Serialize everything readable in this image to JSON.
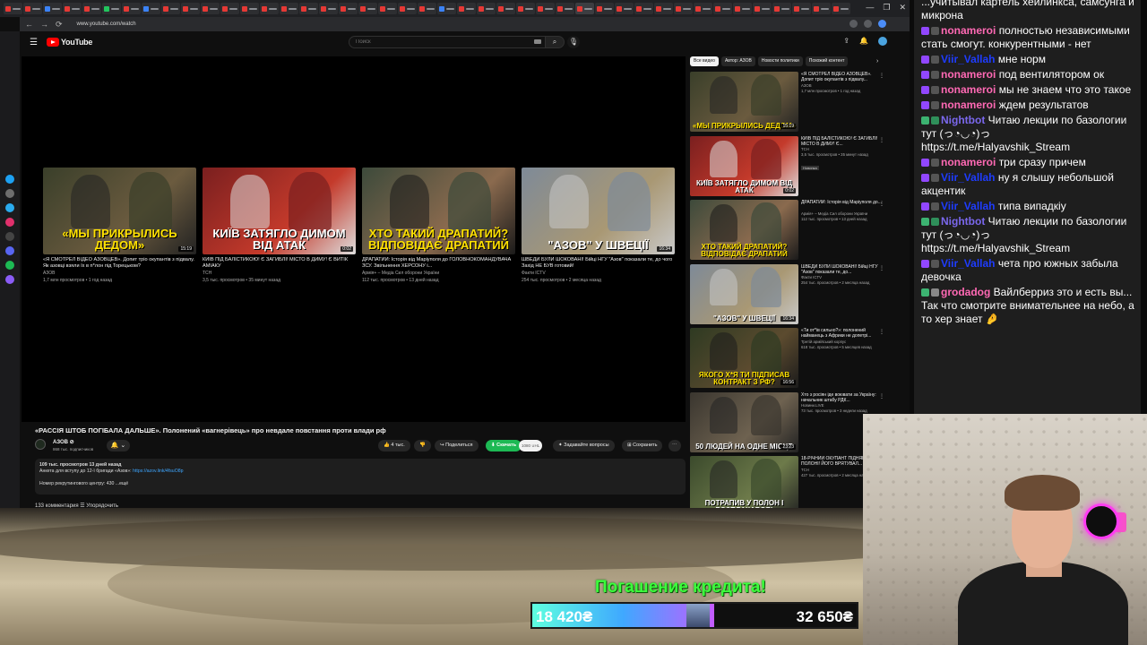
{
  "browser": {
    "url": "www.youtube.com/watch",
    "window_controls": [
      "—",
      "❐",
      "✕"
    ]
  },
  "youtube": {
    "logo_text": "YouTube",
    "search_placeholder": "Поиск",
    "endscreen": [
      {
        "title": "«Я СМОТРЕЛ ВІДЕО АЗОВЦЕВ». Допит тріо окупантів з підвалу. Як азовці взяли їх в п*лон під Торецьком?",
        "channel": "АЗОВ",
        "meta": "1,7 млн просмотров • 1 год назад",
        "duration": "15:19",
        "caption": "«МЫ ПРИКРЫЛИСЬ ДЕДОМ»"
      },
      {
        "title": "КИЇВ ПІД БАЛІСТИКОЮ! Є ЗАГИБЛІ! МІСТО В ДИМУ! Є ВИТІК АМІАКУ",
        "channel": "ТСН",
        "meta": "3,5 тыс. просмотров • 35 минут назад",
        "duration": "0:02",
        "caption": "КИЇВ ЗАТЯГЛО ДИМОМ ВІД АТАК"
      },
      {
        "title": "ДРАПАТИЙ: Історія від Маріуполя до ГОЛОВНОКОМАНДУВАЧА ЗСУ. Звільнення ХЕРСОНУ і...",
        "channel": "Армія+ – Медіа Сил оборони України",
        "meta": "112 тыс. просмотров • 13 дней назад",
        "duration": "",
        "caption": "ХТО ТАКИЙ ДРАПАТИЙ? ВІДПОВІДАЄ ДРАПАТИЙ"
      },
      {
        "title": "ШВЕДИ БУЛИ ШОКОВАНІ! Бійці НГУ \"Азов\" показали те, до чого Захід НЕ БУВ готовий!",
        "channel": "Факти ICTV",
        "meta": "254 тыс. просмотров • 2 месяца назад",
        "duration": "16:34",
        "caption": "\"АЗОВ\" У ШВЕЦІЇ"
      }
    ],
    "video_title": "«РАССІЯ ШТОБ ПОГІБАЛА ДАЛЬШЕ». Полонений «вагнерівець» про невдале повстання проти влади рф",
    "channel": {
      "name": "АЗОВ ⊘",
      "subs": "868 тыс. подписчиков"
    },
    "actions": {
      "likes": "4 тыс.",
      "share": "Поделиться",
      "download": "Скачать",
      "download_quality": "1080 ∪HL",
      "ask": "Задавайте вопросы",
      "save": "Сохранить",
      "more": "⋯"
    },
    "description": {
      "stats": "109 тыс. просмотров  13 дней назад",
      "line1_prefix": "Анкета для вступу до 12-ї бригади «Азов»: ",
      "line1_link": "https://azov.link/4fsuO8p",
      "line2": "Номер рекрутингового центру: 430 ...ещё"
    },
    "comments_header": "133 комментария    ☰ Упорядочить",
    "chips": [
      "Все видео",
      "Автор: АЗОВ",
      "Новости политики",
      "Похожий контент"
    ],
    "related": [
      {
        "title": "«Я СМОТРЕЛ ВІДЕО АЗОВЦЕВ». Допит тріо окупантів з підвалу...",
        "channel": "АЗОВ",
        "meta": "1,7 млн просмотров • 1 год назад",
        "badge": "",
        "duration": "15:19",
        "caption": "«МЫ ПРИКРЫЛИСЬ ДЕДОМ»"
      },
      {
        "title": "КИЇВ ПІД БАЛІСТИКОЮ! Є ЗАГИБЛІ! МІСТО В ДИМУ! Є...",
        "channel": "ТСН",
        "meta": "3,5 тыс. просмотров • 35 минут назад",
        "badge": "Новинка",
        "duration": "0:02",
        "caption": "КИЇВ ЗАТЯГЛО ДИМОМ ВІД АТАК"
      },
      {
        "title": "ДРАПАТИЙ: Історія від Маріуполя до...",
        "channel": "Армія+ – Медіа Сил оборони України",
        "meta": "112 тыс. просмотров • 13 дней назад",
        "badge": "",
        "duration": "",
        "caption": "ХТО ТАКИЙ ДРАПАТИЙ? ВІДПОВІДАЄ ДРАПАТИЙ"
      },
      {
        "title": "ШВЕДИ БУЛИ ШОКОВАНІ! Бійці НГУ \"Азов\" показали те, до...",
        "channel": "Факти ICTV",
        "meta": "254 тыс. просмотров • 2 месяца назад",
        "badge": "",
        "duration": "16:34",
        "caption": "\"АЗОВ\" У ШВЕЦІЇ"
      },
      {
        "title": "«Ти от*їв сильно?»: полонений найманець з Африки не допетрі...",
        "channel": "Третій армійський корпус",
        "meta": "618 тыс. просмотров • 5 месяцев назад",
        "badge": "",
        "duration": "16:56",
        "caption": "ЯКОГО Х*Я ТИ ПІДПИСАВ КОНТРАКТ З РФ?"
      },
      {
        "title": "Хто з росіян іде воювати за Україну: начальник штабу РДК...",
        "channel": "Новини.LIVE",
        "meta": "73 тыс. просмотров • 3 недели назад",
        "badge": "",
        "duration": "23:23",
        "caption": "50 ЛЮДЕЙ НА ОДНЕ МІСЦЕ"
      },
      {
        "title": "18-РІЧНИЙ ОКУПАНТ ПІДНЯВ ПОЛОНІ! ЙОГО ВРЯТУВАЛ...",
        "channel": "ТСН",
        "meta": "427 тыс. просмотров • 2 месяца назад",
        "badge": "",
        "duration": "",
        "caption": "ПОТРАПИВ У ПОЛОН І РОЗПЛАКАВСЯ!"
      }
    ]
  },
  "chat": {
    "messages": [
      {
        "user": "",
        "color": "#ffffff",
        "text": "...учитывал картель хейлинкса, самсунга и микрона"
      },
      {
        "user": "nonameroi",
        "color": "#ff69b4",
        "text": "полностью независимыми стать смогут. конкурентными - нет"
      },
      {
        "user": "Viir_Vallah",
        "color": "#1e3cff",
        "text": "мне норм"
      },
      {
        "user": "nonameroi",
        "color": "#ff69b4",
        "text": "под вентилятором ок"
      },
      {
        "user": "nonameroi",
        "color": "#ff69b4",
        "text": "мы не знаем что это такое"
      },
      {
        "user": "nonameroi",
        "color": "#ff69b4",
        "text": "ждем результатов"
      },
      {
        "user": "Nightbot",
        "color": "#7b68ee",
        "text": "Читаю лекции по базологии тут (っ◔◡◔)っ https://t.me/Halyavshik_Stream"
      },
      {
        "user": "nonameroi",
        "color": "#ff69b4",
        "text": "три сразу причем"
      },
      {
        "user": "Viir_Vallah",
        "color": "#1e3cff",
        "text": "ну я слышу небольшой акцентик"
      },
      {
        "user": "Viir_Vallah",
        "color": "#1e3cff",
        "text": "типа випадкiу"
      },
      {
        "user": "Nightbot",
        "color": "#7b68ee",
        "text": "Читаю лекции по базологии тут (っ◔◡◔)っ https://t.me/Halyavshik_Stream"
      },
      {
        "user": "Viir_Vallah",
        "color": "#1e3cff",
        "text": "чета про южных забыла девочка"
      },
      {
        "user": "grodadog",
        "color": "#ff69b4",
        "text": "Вайлберриз это и есть вы... Так что смотрите внимательнее на небо, а то хер знает 🤌"
      }
    ]
  },
  "overlay": {
    "credit_title": "Погашение кредита!",
    "credit_current": "18 420₴",
    "credit_target": "32 650₴",
    "credit_progress": 0.56
  }
}
